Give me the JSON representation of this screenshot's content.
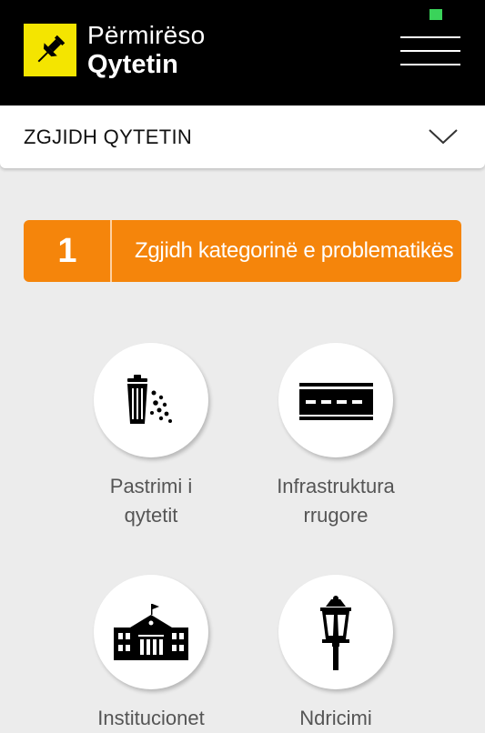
{
  "header": {
    "logo_line1": "Përmirëso",
    "logo_line2": "Qytetin",
    "logo_icon": "pushpin-icon",
    "menu_icon": "hamburger-menu-icon",
    "status_color": "#3ad35a"
  },
  "city_select": {
    "label": "ZGJIDH QYTETIN",
    "icon": "chevron-down-icon"
  },
  "step": {
    "number": "1",
    "text": "Zgjidh kategorinë e problematikës",
    "color": "#f5850b"
  },
  "categories": [
    {
      "line1": "Pastrimi i",
      "line2": "qytetit",
      "icon": "trash-can-icon"
    },
    {
      "line1": "Infrastruktura",
      "line2": "rrugore",
      "icon": "road-icon"
    },
    {
      "line1": "Institucionet",
      "line2": "",
      "icon": "school-building-icon"
    },
    {
      "line1": "Ndricimi",
      "line2": "",
      "icon": "street-lamp-icon"
    }
  ]
}
